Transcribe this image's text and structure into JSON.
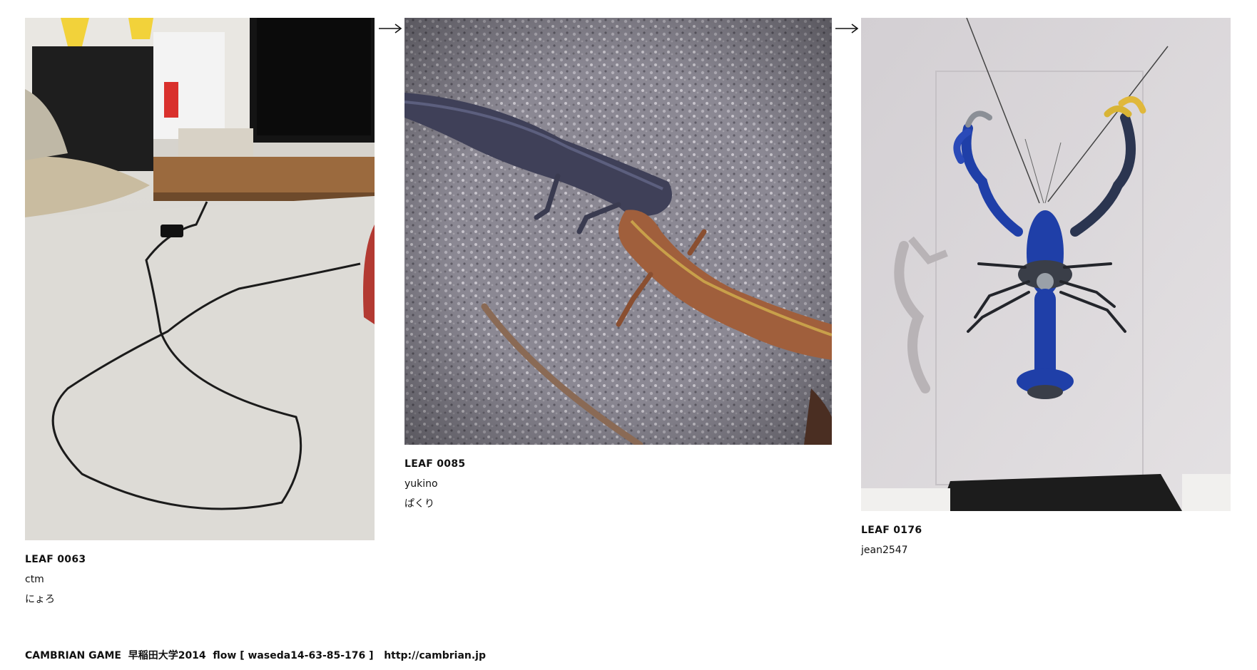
{
  "flow": {
    "leaves": [
      {
        "id_label": "LEAF 0063",
        "user": "ctm",
        "caption": "にょろ",
        "photo_subject": "black cable on a carpet",
        "colors": {
          "floor": "#dcdad5",
          "wall": "#e8e6e2",
          "cable": "#1b1b1b"
        }
      },
      {
        "id_label": "LEAF 0085",
        "user": "yukino",
        "caption": "ぱくり",
        "photo_subject": "two lizards on gravel",
        "colors": {
          "gravel": "#8d8a94",
          "lizard_dark": "#3e3f55",
          "lizard_brown": "#9a5a38"
        }
      },
      {
        "id_label": "LEAF 0176",
        "user": "jean2547",
        "caption": "",
        "photo_subject": "mechanical blue crayfish sculpture",
        "colors": {
          "wall": "#d9d6d9",
          "crayfish": "#1f3fa8",
          "base": "#1c1c1c"
        }
      }
    ],
    "arrow_icon": "right-arrow-icon"
  },
  "footer": {
    "title": "CAMBRIAN GAME",
    "event": "早稲田大学2014",
    "flow_label": "flow [ waseda14-63-85-176 ]",
    "link_text": "http://cambrian.jp"
  }
}
